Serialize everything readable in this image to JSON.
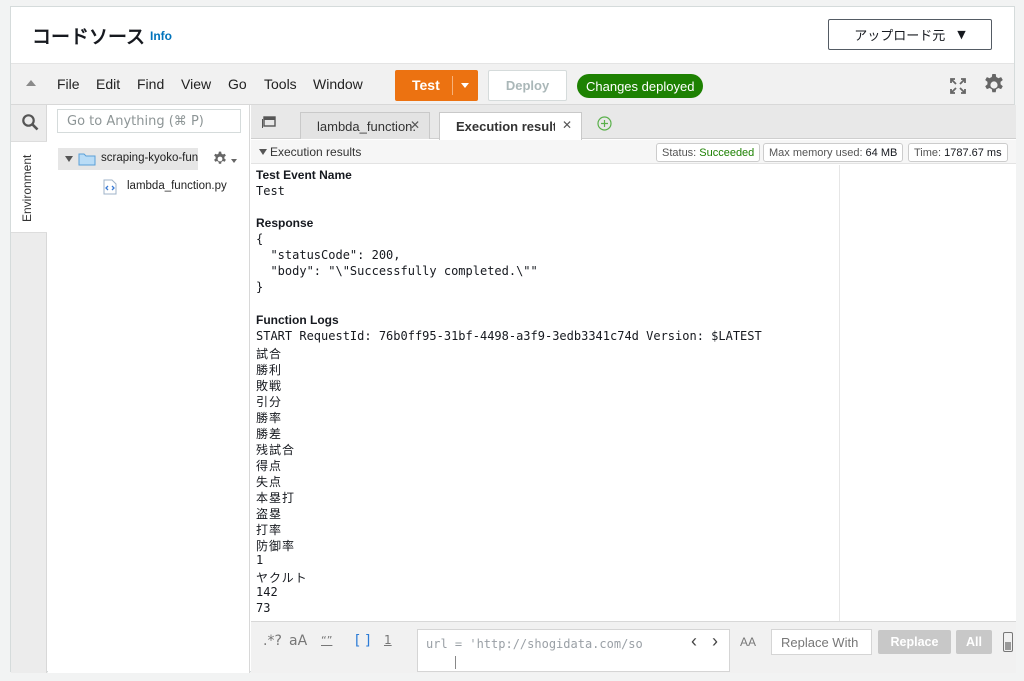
{
  "header": {
    "title": "コードソース",
    "info_label": "Info",
    "upload_label": "アップロード元"
  },
  "menu": {
    "items": [
      "File",
      "Edit",
      "Find",
      "View",
      "Go",
      "Tools",
      "Window"
    ],
    "test_label": "Test",
    "deploy_label": "Deploy",
    "deployed_badge": "Changes deployed"
  },
  "sidebar": {
    "search_placeholder": "Go to Anything (⌘ P)",
    "environment_tab": "Environment",
    "folder_name": "scraping-kyoko-function",
    "file_name": "lambda_function.py"
  },
  "tabs": [
    {
      "label": "lambda_function.py",
      "active": false
    },
    {
      "label": "Execution results",
      "active": true
    }
  ],
  "results": {
    "header_label": "Execution results",
    "status_label": "Status:",
    "status_value": "Succeeded",
    "memory_label": "Max memory used:",
    "memory_value": "64 MB",
    "time_label": "Time:",
    "time_value": "1787.67 ms",
    "test_event_heading": "Test Event Name",
    "test_event_value": "Test",
    "response_heading": "Response",
    "response_lines": [
      "{",
      "  \"statusCode\": 200,",
      "  \"body\": \"\\\"Successfully completed.\\\"\"",
      "}"
    ],
    "logs_heading": "Function Logs",
    "log_start": "START RequestId: 76b0ff95-31bf-4498-a3f9-3edb3341c74d Version: $LATEST",
    "log_lines": [
      "試合",
      "勝利",
      "敗戦",
      "引分",
      "勝率",
      "勝差",
      "残試合",
      "得点",
      "失点",
      "本塁打",
      "盗塁",
      "打率",
      "防御率",
      "1",
      "ヤクルト",
      "142",
      "73"
    ]
  },
  "findbar": {
    "regex_label": ".*?",
    "case_label": "aA",
    "word_label": "“”",
    "selection_label": "[ ]",
    "wrap_label": "1",
    "find_value": "url = 'http://shogidata.com/so",
    "preserve_case_label": "AA",
    "replace_placeholder": "Replace With",
    "replace_label": "Replace",
    "all_label": "All"
  },
  "colors": {
    "accent_orange": "#ec7211",
    "success_green": "#1d8102",
    "link_blue": "#0073bb"
  }
}
